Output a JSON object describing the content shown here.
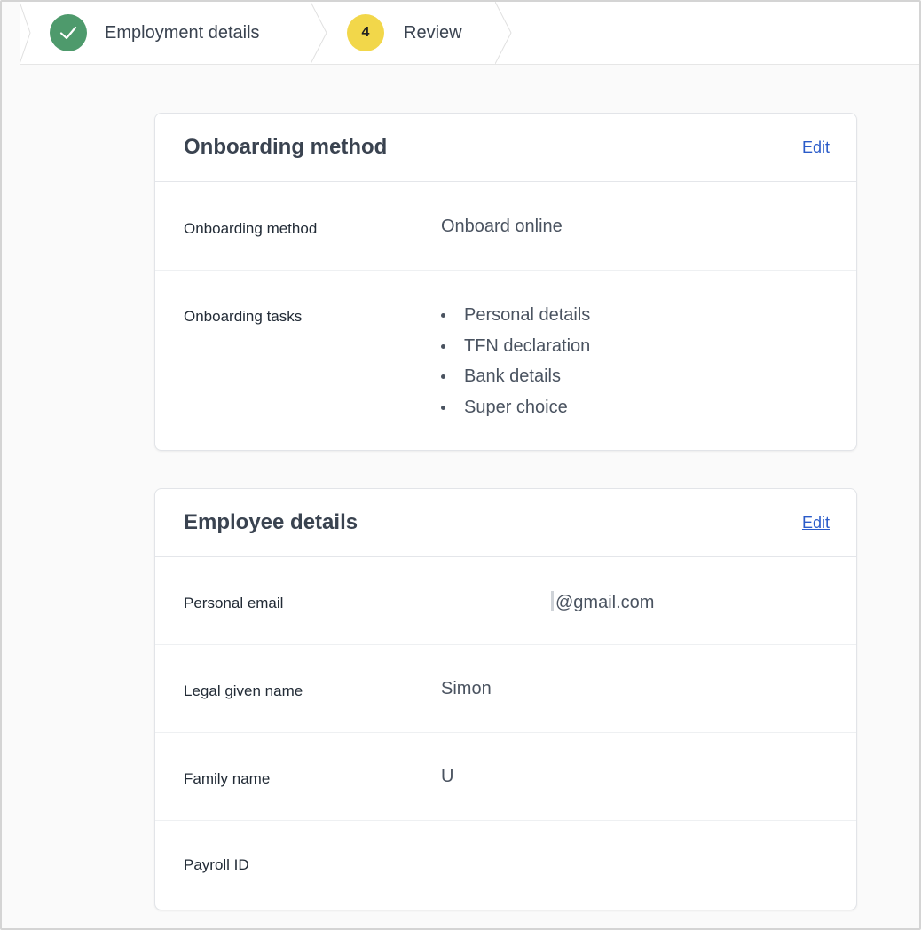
{
  "stepper": {
    "steps": [
      {
        "label": "Employment details",
        "state": "complete",
        "icon": "check-icon",
        "color": "#4e9a6c"
      },
      {
        "label": "Review",
        "number": "4",
        "state": "current",
        "color": "#f2d74a"
      }
    ]
  },
  "onboarding_card": {
    "title": "Onboarding method",
    "edit_label": "Edit",
    "rows": {
      "method": {
        "label": "Onboarding method",
        "value": "Onboard online"
      },
      "tasks": {
        "label": "Onboarding tasks",
        "items": [
          "Personal details",
          "TFN declaration",
          "Bank details",
          "Super choice"
        ]
      }
    }
  },
  "employee_card": {
    "title": "Employee details",
    "edit_label": "Edit",
    "rows": [
      {
        "label": "Personal email",
        "value": "@gmail.com"
      },
      {
        "label": "Legal given name",
        "value": "Simon"
      },
      {
        "label": "Family name",
        "value": "U"
      },
      {
        "label": "Payroll ID",
        "value": ""
      }
    ]
  },
  "colors": {
    "link": "#2a5bc9",
    "complete": "#4e9a6c",
    "current": "#f2d74a"
  }
}
